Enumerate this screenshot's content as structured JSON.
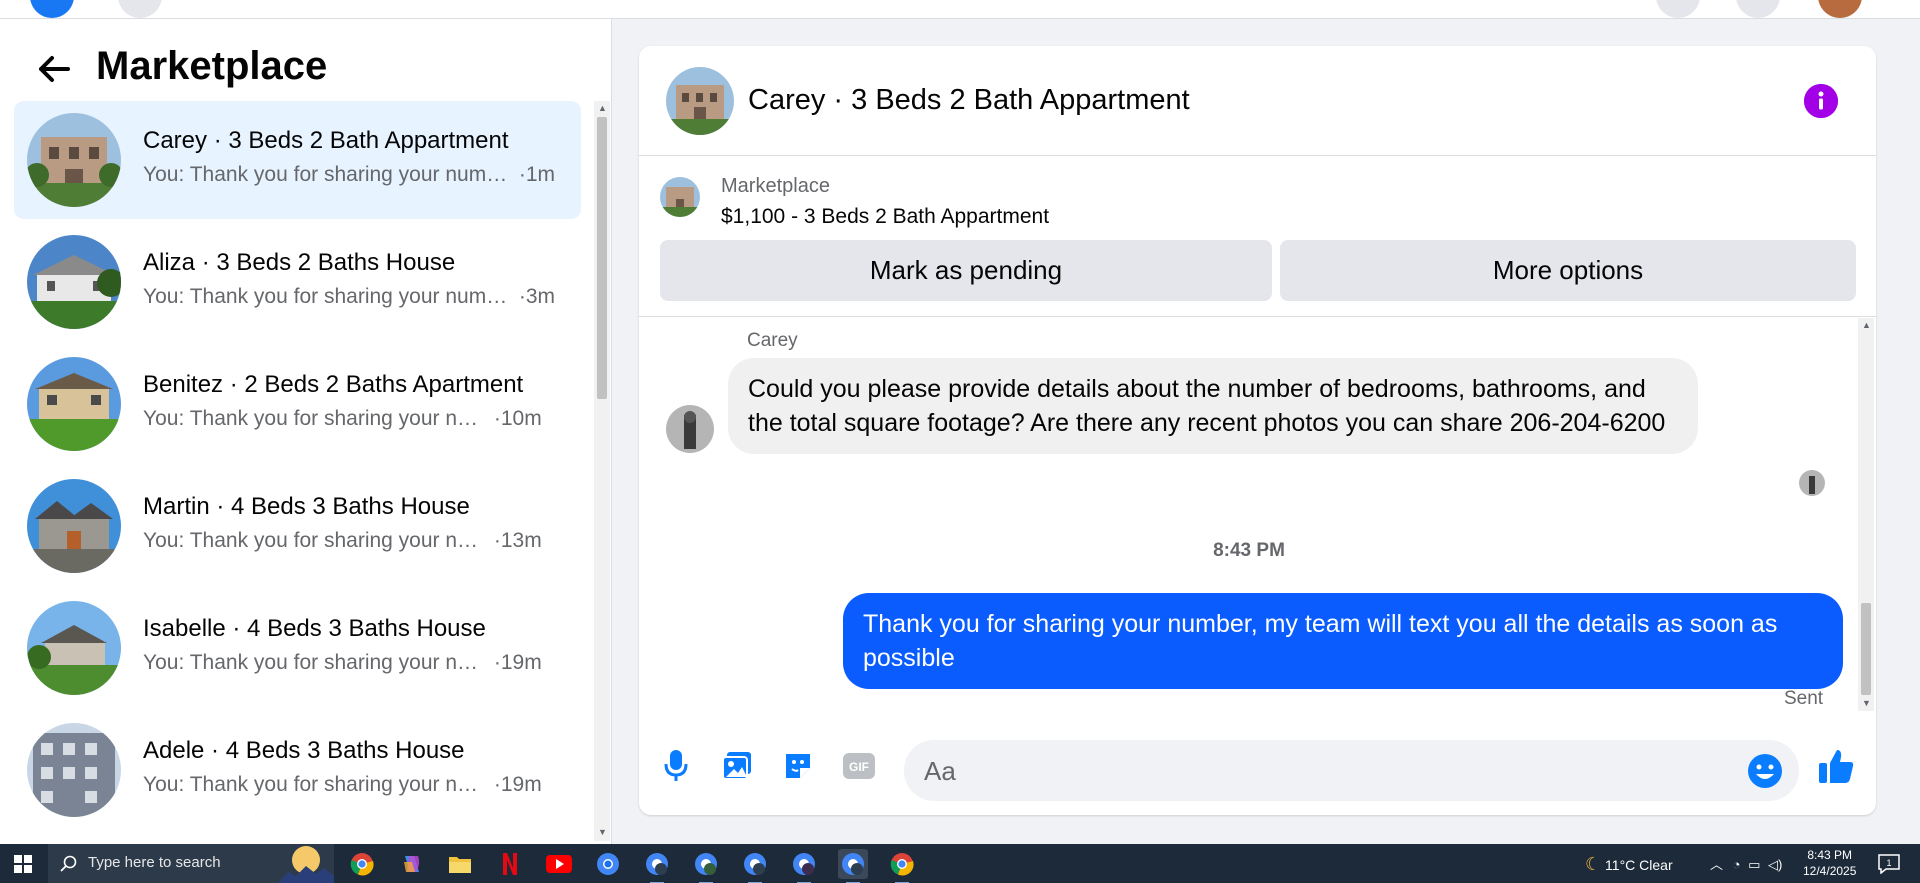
{
  "left_panel": {
    "title": "Marketplace",
    "conversations": [
      {
        "name": "Carey · 3 Beds 2 Bath Appartment",
        "snippet": "You: Thank you for sharing your number, my team will text you all the details as soon as possible",
        "time": "·1m",
        "active": true
      },
      {
        "name": "Aliza · 3 Beds 2 Baths House",
        "snippet": "You: Thank you for sharing your number, my team will text you all the details as soon as possible",
        "time": "·3m",
        "active": false
      },
      {
        "name": "Benitez · 2 Beds 2 Baths Apartment",
        "snippet": "You: Thank you for sharing your number, my team will text you all the details as soon as possible",
        "time": "·10m",
        "active": false
      },
      {
        "name": "Martin · 4 Beds 3 Baths House",
        "snippet": "You: Thank you for sharing your number, my team will text you all the details as soon as possible",
        "time": "·13m",
        "active": false
      },
      {
        "name": "Isabelle · 4 Beds 3 Baths House",
        "snippet": "You: Thank you for sharing your number, my team will text you all the details as soon as possible",
        "time": "·19m",
        "active": false
      },
      {
        "name": "Adele · 4 Beds 3 Baths House",
        "snippet": "You: Thank you for sharing your number, my team will text you all the details as soon as possible",
        "time": "·19m",
        "active": false
      }
    ]
  },
  "chat": {
    "title": "Carey · 3 Beds 2 Bath Appartment",
    "marketplace_label": "Marketplace",
    "listing": "$1,100 - 3 Beds 2 Bath Appartment",
    "mark_pending": "Mark as pending",
    "more_options": "More options",
    "sender_name": "Carey",
    "incoming_message": "Could you please provide details about the number of bedrooms, bathrooms, and the total square footage? Are there any recent photos you can share 206-204-6200",
    "timestamp": "8:43 PM",
    "outgoing_message": "Thank you for  sharing your number, my team will text you all the details as soon as possible",
    "status": "Sent",
    "input_placeholder": "Aa"
  },
  "colors": {
    "accent_blue": "#0a5cff",
    "active_conv": "#e7f3ff",
    "info_purple": "#a200e6"
  },
  "taskbar": {
    "search_placeholder": "Type here to search",
    "apps": [
      "chrome-icon",
      "copilot-icon",
      "file-explorer-icon",
      "netflix-icon",
      "youtube-icon",
      "chrome-profile-icon",
      "chrome-profile-icon",
      "chrome-profile-icon",
      "chrome-profile-icon",
      "chrome-profile-icon",
      "chrome-profile-icon",
      "chrome-icon"
    ],
    "weather": "11°C  Clear",
    "time": "8:43 PM",
    "date": "12/4/2025",
    "notification_count": "1"
  }
}
